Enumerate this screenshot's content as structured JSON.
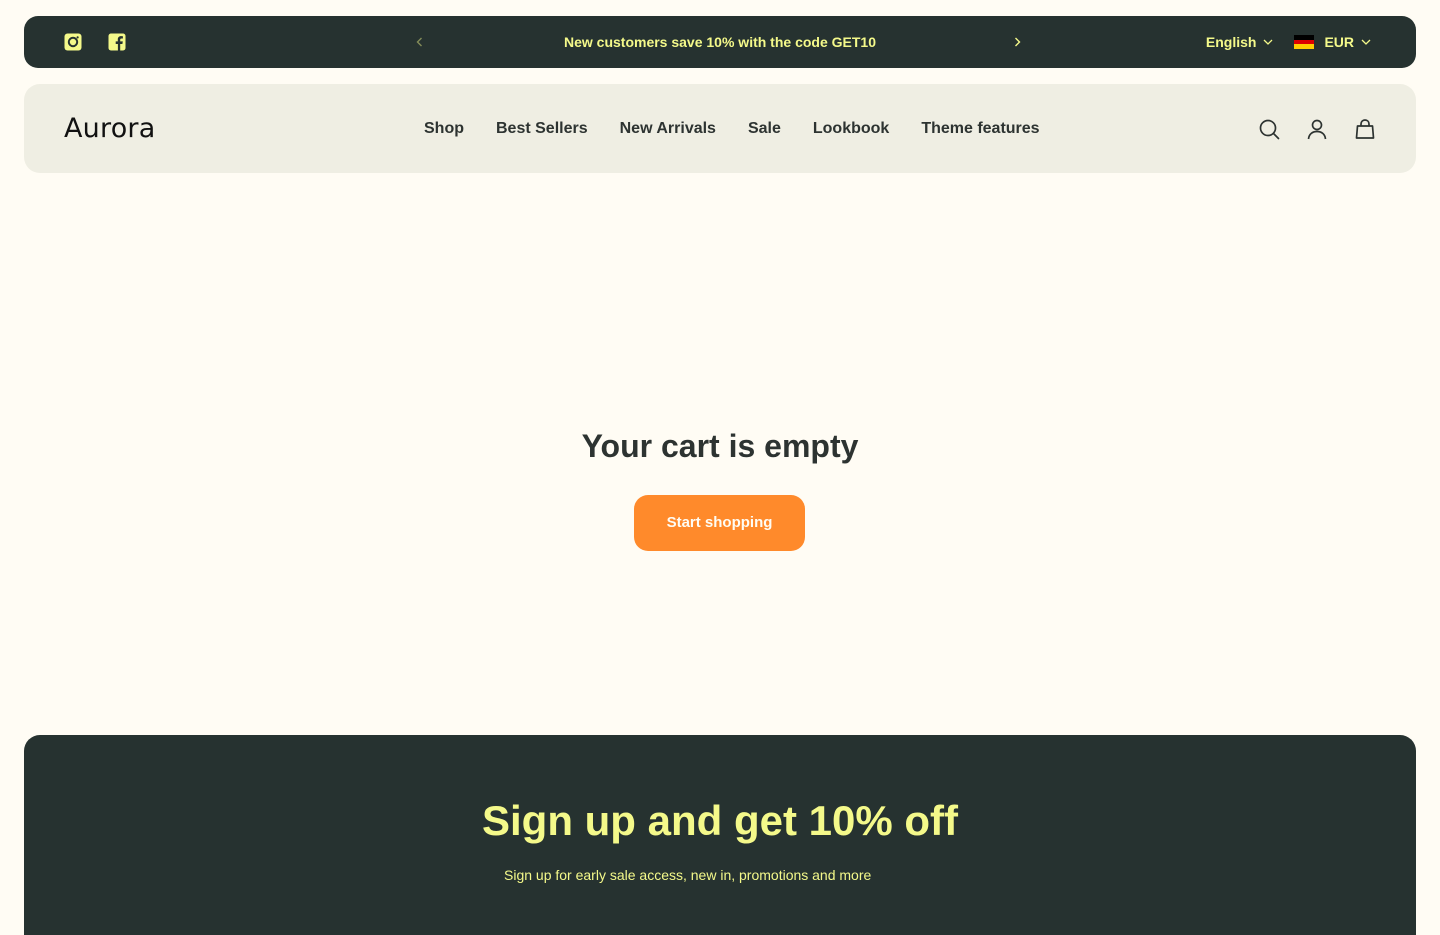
{
  "colors": {
    "page_bg": "#FFFCF4",
    "dark": "#263230",
    "accent_yellow": "#F4F98A",
    "header_bg": "#EFEEE3",
    "cta_orange": "#FF8A2B",
    "text": "#2D3331"
  },
  "announcement": {
    "social_icons": [
      "instagram-icon",
      "facebook-icon"
    ],
    "message": "New customers save 10% with the code GET10",
    "language": "English",
    "currency": "EUR",
    "currency_flag": "germany-flag-icon"
  },
  "header": {
    "logo": "Aurora",
    "nav": [
      "Shop",
      "Best Sellers",
      "New Arrivals",
      "Sale",
      "Lookbook",
      "Theme features"
    ],
    "icons": [
      "search-icon",
      "account-icon",
      "cart-icon"
    ]
  },
  "main": {
    "title": "Your cart is empty",
    "cta": "Start shopping"
  },
  "newsletter": {
    "title": "Sign up and get 10% off",
    "subtitle": "Sign up for early sale access, new in, promotions and more"
  }
}
